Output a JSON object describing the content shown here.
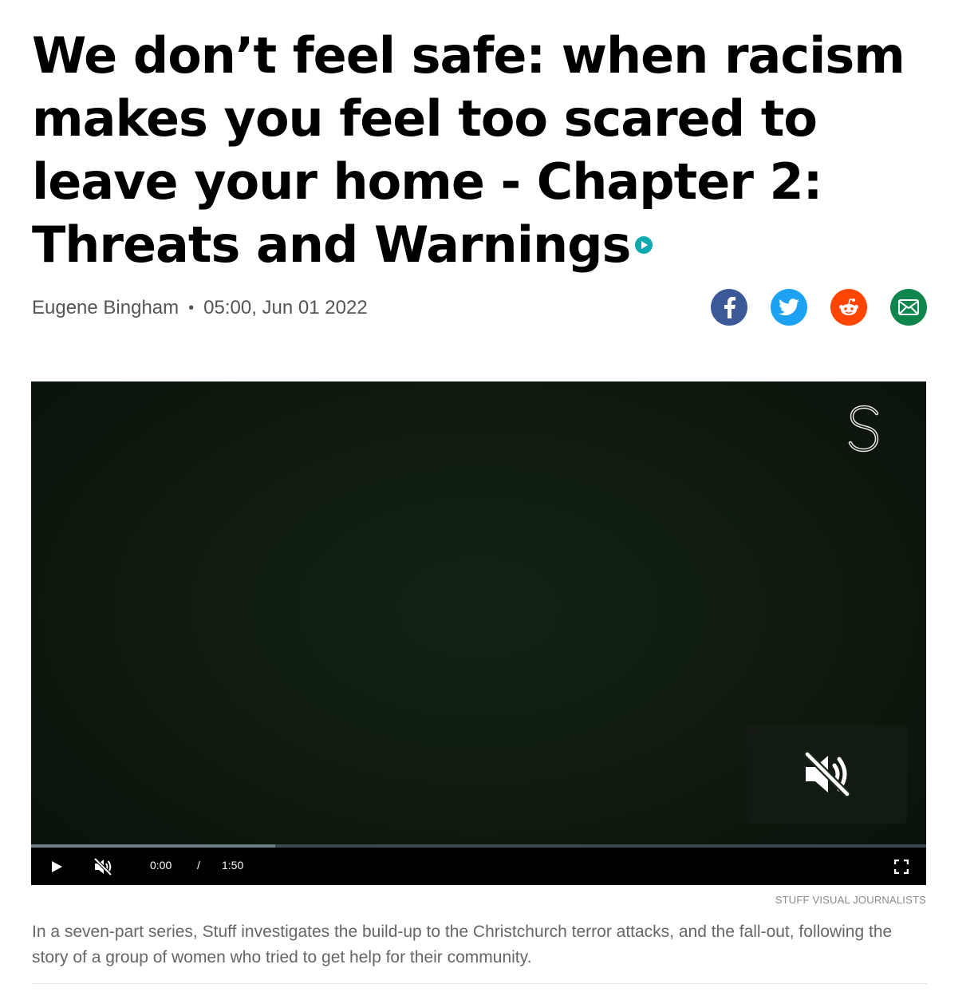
{
  "article": {
    "headline": "We don’t feel safe: when racism makes you feel too scared to leave your home - Chapter 2: Threats and Warnings",
    "author": "Eugene Bingham",
    "separator": "•",
    "timestamp": "05:00, Jun 01 2022",
    "standfirst": "In a seven-part series, Stuff investigates the build-up to the Christchurch terror attacks, and the fall-out, following the story of a group of women who tried to get help for their community."
  },
  "share": {
    "buttons": [
      {
        "icon": "facebook-icon",
        "color": "#3b5998"
      },
      {
        "icon": "twitter-icon",
        "color": "#1da1f2"
      },
      {
        "icon": "reddit-icon",
        "color": "#ff4500"
      },
      {
        "icon": "email-icon",
        "color": "#10864f"
      }
    ]
  },
  "video": {
    "current_time": "0:00",
    "time_separator": "/",
    "duration": "1:50",
    "buffered_fraction": 0.273,
    "muted": true,
    "credit": "STUFF VISUAL JOURNALISTS"
  }
}
